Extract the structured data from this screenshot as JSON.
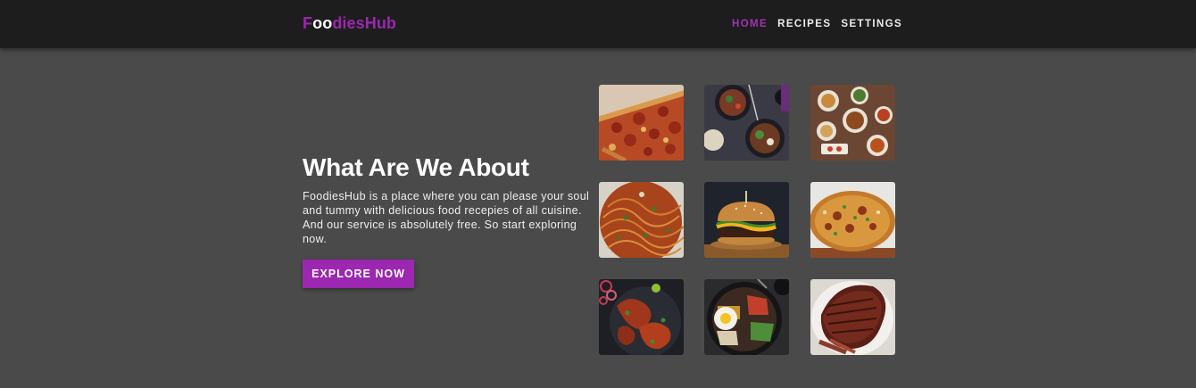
{
  "navbar": {
    "brand": {
      "part1": "F",
      "part2": "oo",
      "part3": "diesHub"
    },
    "links": [
      {
        "label": "HOME",
        "active": true
      },
      {
        "label": "RECIPES",
        "active": false
      },
      {
        "label": "SETTINGS",
        "active": false
      }
    ]
  },
  "hero": {
    "title": "What Are We About",
    "description": "FoodiesHub is a place where you can please your soul and tummy with delicious food recepies of all cuisine. And our service is absolutely free. So start exploring now.",
    "button_label": "EXPLORE NOW"
  },
  "gallery": {
    "images": [
      {
        "icon": "pizza-image"
      },
      {
        "icon": "rice-bowls-image"
      },
      {
        "icon": "dinner-spread-image"
      },
      {
        "icon": "spaghetti-image"
      },
      {
        "icon": "burger-image"
      },
      {
        "icon": "biryani-image"
      },
      {
        "icon": "grilled-chicken-image"
      },
      {
        "icon": "bibimbap-image"
      },
      {
        "icon": "steak-image"
      }
    ]
  },
  "colors": {
    "accent": "#9c27b0",
    "navbar_bg": "#1d1d1d",
    "page_bg": "#4a4a4a"
  }
}
